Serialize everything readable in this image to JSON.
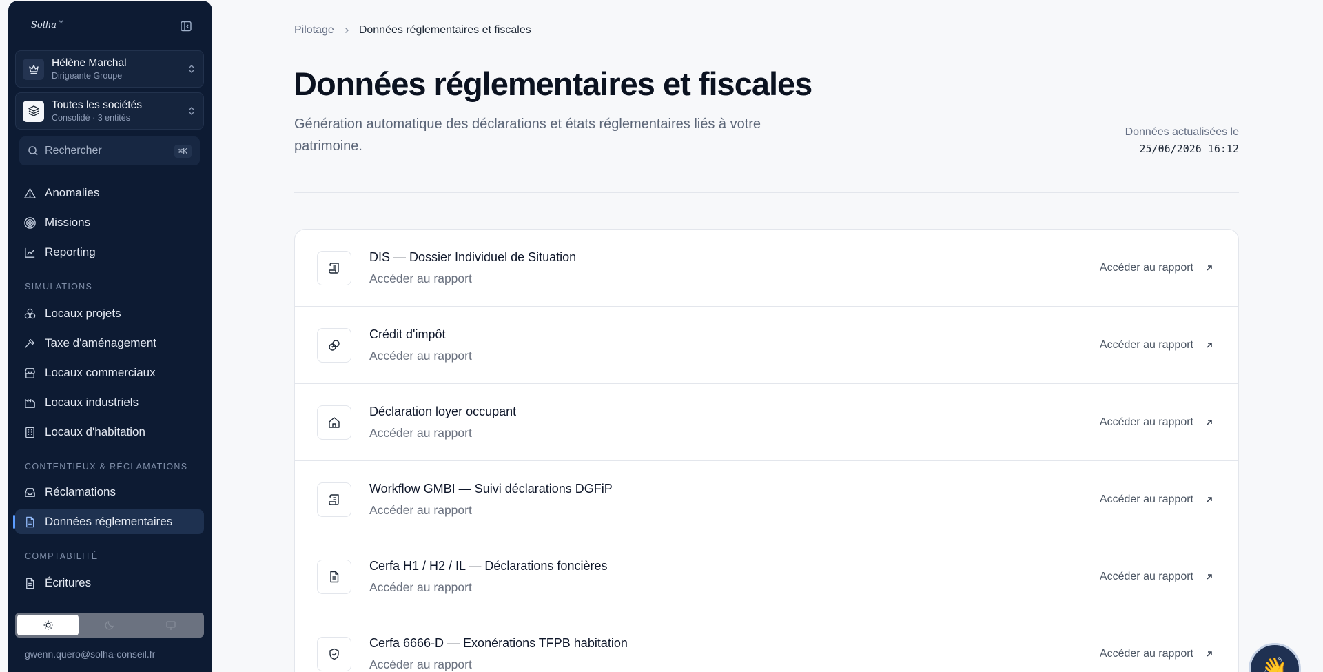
{
  "sidebar": {
    "logo": "Solha",
    "user": {
      "name": "Hélène Marchal",
      "role": "Dirigeante Groupe"
    },
    "company": {
      "name": "Toutes les sociétés",
      "sub": "Consolidé · 3 entités"
    },
    "search": {
      "placeholder": "Rechercher",
      "shortcut": "⌘K"
    },
    "top_items": [
      {
        "label": "Anomalies",
        "icon": "alert-triangle-icon"
      },
      {
        "label": "Missions",
        "icon": "target-icon"
      },
      {
        "label": "Reporting",
        "icon": "line-chart-icon"
      }
    ],
    "sections": [
      {
        "title": "SIMULATIONS",
        "items": [
          {
            "label": "Locaux projets",
            "icon": "boxes-icon"
          },
          {
            "label": "Taxe d'aménagement",
            "icon": "hammer-icon"
          },
          {
            "label": "Locaux commerciaux",
            "icon": "store-icon"
          },
          {
            "label": "Locaux industriels",
            "icon": "factory-icon"
          },
          {
            "label": "Locaux d'habitation",
            "icon": "building-icon"
          }
        ]
      },
      {
        "title": "CONTENTIEUX & RÉCLAMATIONS",
        "items": [
          {
            "label": "Réclamations",
            "icon": "inbox-icon"
          },
          {
            "label": "Données réglementaires",
            "icon": "file-text-icon",
            "active": true
          }
        ]
      },
      {
        "title": "COMPTABILITÉ",
        "items": [
          {
            "label": "Écritures",
            "icon": "file-text-icon"
          }
        ]
      }
    ],
    "theme_options": [
      "sun-icon",
      "moon-icon",
      "monitor-icon"
    ],
    "email": "gwenn.quero@solha-conseil.fr"
  },
  "breadcrumb": {
    "root": "Pilotage",
    "current": "Données réglementaires et fiscales"
  },
  "header": {
    "title": "Données réglementaires et fiscales",
    "description": "Génération automatique des déclarations et états réglementaires liés à votre patrimoine.",
    "updated_label": "Données actualisées le",
    "updated_value": "25/06/2026 16:12"
  },
  "reports": [
    {
      "title": "DIS — Dossier Individuel de Situation",
      "subtitle": "Accéder au rapport",
      "link": "Accéder au rapport",
      "icon": "scroll-icon"
    },
    {
      "title": "Crédit d'impôt",
      "subtitle": "Accéder au rapport",
      "link": "Accéder au rapport",
      "icon": "coins-icon"
    },
    {
      "title": "Déclaration loyer occupant",
      "subtitle": "Accéder au rapport",
      "link": "Accéder au rapport",
      "icon": "home-icon"
    },
    {
      "title": "Workflow GMBI — Suivi déclarations DGFiP",
      "subtitle": "Accéder au rapport",
      "link": "Accéder au rapport",
      "icon": "scroll-icon"
    },
    {
      "title": "Cerfa H1 / H2 / IL — Déclarations foncières",
      "subtitle": "Accéder au rapport",
      "link": "Accéder au rapport",
      "icon": "file-text-icon"
    },
    {
      "title": "Cerfa 6666-D — Exonérations TFPB habitation",
      "subtitle": "Accéder au rapport",
      "link": "Accéder au rapport",
      "icon": "shield-check-icon"
    }
  ],
  "colors": {
    "sidebar": "#0d1b33",
    "accent": "#5b9cff",
    "background": "#f7f8fa"
  }
}
